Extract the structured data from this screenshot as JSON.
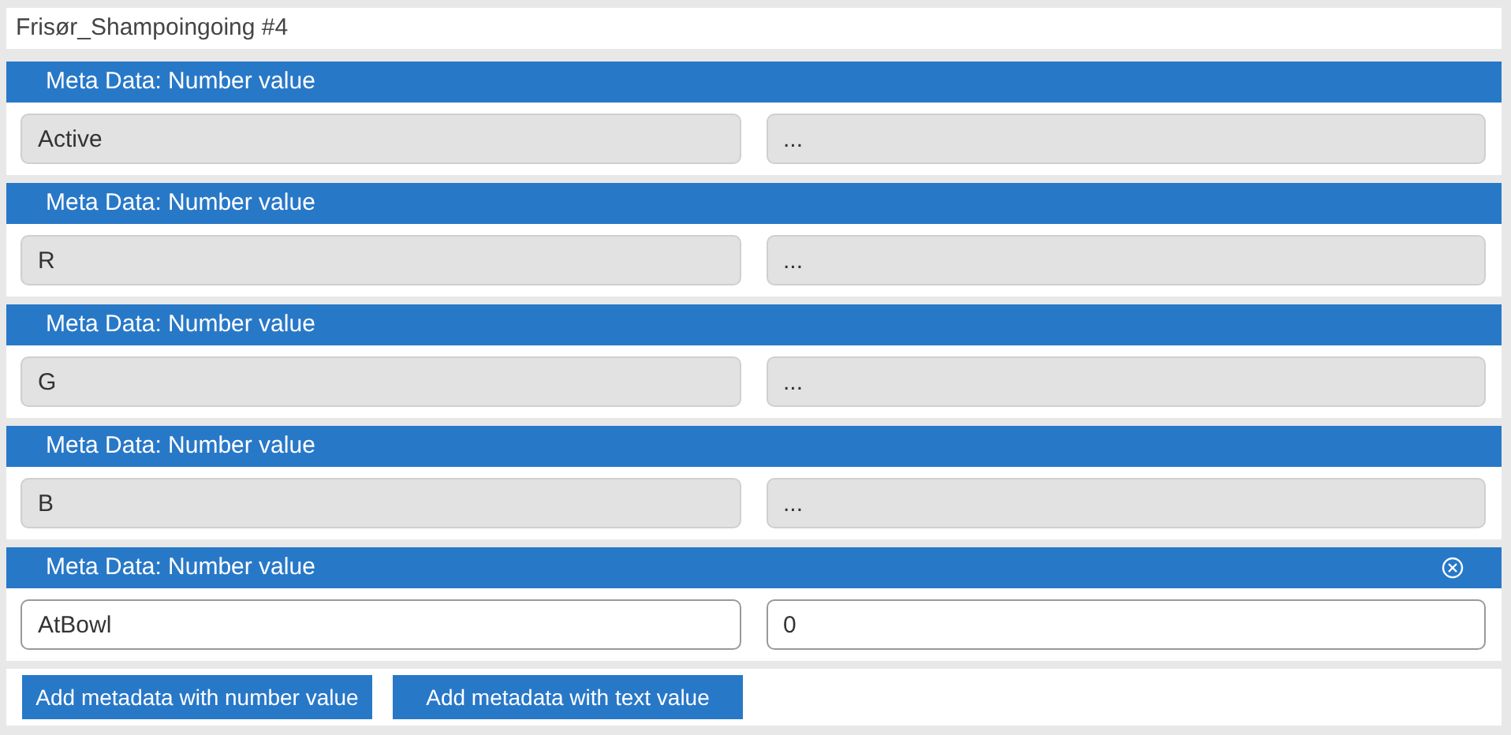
{
  "title": "Frisør_Shampoingoing #4",
  "entries": [
    {
      "header": "Meta Data: Number value",
      "name": "Active",
      "value": "...",
      "disabled": true,
      "removable": false
    },
    {
      "header": "Meta Data: Number value",
      "name": "R",
      "value": "...",
      "disabled": true,
      "removable": false
    },
    {
      "header": "Meta Data: Number value",
      "name": "G",
      "value": "...",
      "disabled": true,
      "removable": false
    },
    {
      "header": "Meta Data: Number value",
      "name": "B",
      "value": "...",
      "disabled": true,
      "removable": false
    },
    {
      "header": "Meta Data: Number value",
      "name": "AtBowl",
      "value": "0",
      "disabled": false,
      "removable": true
    }
  ],
  "buttons": [
    "Add metadata with number value",
    "Add metadata with text value"
  ]
}
